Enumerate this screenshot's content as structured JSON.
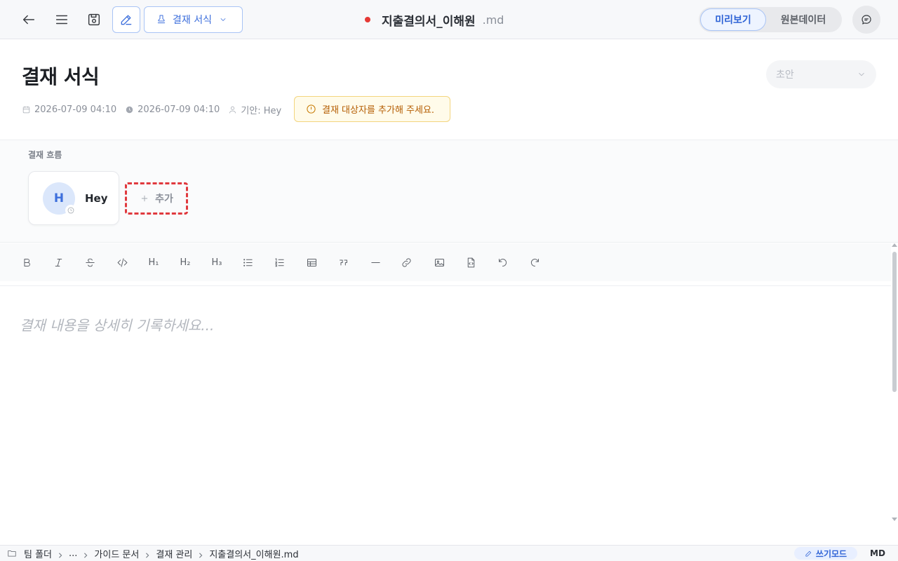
{
  "topbar": {
    "template_label": "결재 서식",
    "doc_name": "지출결의서_이해원",
    "doc_ext": ".md",
    "view_preview": "미리보기",
    "view_raw": "원본데이터",
    "icons": [
      "back-arrow-icon",
      "menu-icon",
      "save-icon",
      "pencil-icon",
      "stamp-icon",
      "chevron-down-icon",
      "chat-icon"
    ]
  },
  "header": {
    "title": "결재 서식",
    "status": "초안",
    "created": "2026-07-09 04:10",
    "modified": "2026-07-09 04:10",
    "drafter": "기안: Hey",
    "warning": "결재 대상자를 추가해 주세요."
  },
  "flow": {
    "label": "결재 흐름",
    "approvers": [
      {
        "initial": "H",
        "name": "Hey"
      }
    ],
    "add_label": "추가"
  },
  "toolbar": {
    "tools": [
      {
        "name": "bold",
        "label": "B"
      },
      {
        "name": "italic",
        "label": "I"
      },
      {
        "name": "strikethrough",
        "label": "S"
      },
      {
        "name": "code",
        "label": "</>"
      },
      {
        "name": "heading1",
        "label": "H₁"
      },
      {
        "name": "heading2",
        "label": "H₂"
      },
      {
        "name": "heading3",
        "label": "H₃"
      }
    ]
  },
  "editor": {
    "placeholder": "결재 내용을 상세히 기록하세요..."
  },
  "statusbar": {
    "crumbs": [
      "팀 폴더",
      "...",
      "가이드 문서",
      "결재 관리",
      "지출결의서_이해원.md"
    ],
    "mode": "쓰기모드",
    "format": "MD"
  },
  "colors": {
    "accent": "#3d6fdc",
    "warning_text": "#b45c00",
    "warning_bg": "#fffbea",
    "unsaved_dot": "#e53935",
    "highlight_dash": "#e0393e"
  }
}
